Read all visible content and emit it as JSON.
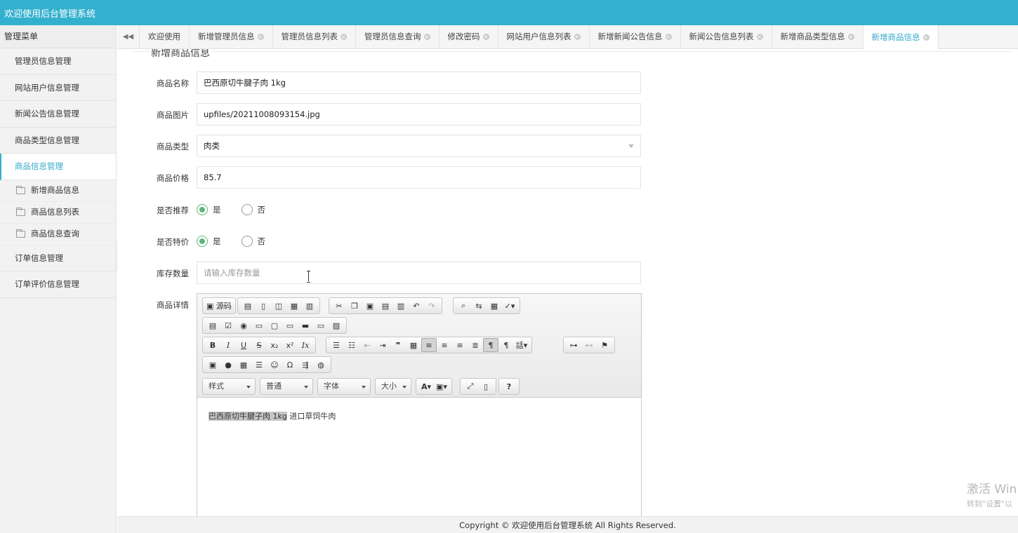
{
  "app": {
    "title": "欢迎使用后台管理系统"
  },
  "sidebar": {
    "header": "管理菜单",
    "items": [
      {
        "label": "管理员信息管理"
      },
      {
        "label": "网站用户信息管理"
      },
      {
        "label": "新闻公告信息管理"
      },
      {
        "label": "商品类型信息管理"
      },
      {
        "label": "商品信息管理"
      }
    ],
    "subitems": [
      {
        "label": "新增商品信息"
      },
      {
        "label": "商品信息列表"
      },
      {
        "label": "商品信息查询"
      }
    ],
    "items_after": [
      {
        "label": "订单信息管理"
      },
      {
        "label": "订单评价信息管理"
      }
    ]
  },
  "tabs": [
    {
      "label": "欢迎使用"
    },
    {
      "label": "新增管理员信息"
    },
    {
      "label": "管理员信息列表"
    },
    {
      "label": "管理员信息查询"
    },
    {
      "label": "修改密码"
    },
    {
      "label": "网站用户信息列表"
    },
    {
      "label": "新增新闻公告信息"
    },
    {
      "label": "新闻公告信息列表"
    },
    {
      "label": "新增商品类型信息"
    },
    {
      "label": "新增商品信息"
    }
  ],
  "form": {
    "legend": "新增商品信息",
    "name": {
      "label": "商品名称",
      "value": "巴西原切牛腱子肉 1kg"
    },
    "image": {
      "label": "商品图片",
      "value": "upfiles/20211008093154.jpg"
    },
    "type": {
      "label": "商品类型",
      "value": "肉类"
    },
    "price": {
      "label": "商品价格",
      "value": "85.7"
    },
    "recommend": {
      "label": "是否推荐",
      "yes": "是",
      "no": "否"
    },
    "special": {
      "label": "是否特价",
      "yes": "是",
      "no": "否"
    },
    "stock": {
      "label": "库存数量",
      "placeholder": "请输入库存数量"
    },
    "detail": {
      "label": "商品详情"
    }
  },
  "editor": {
    "source_label": "源码",
    "combos": {
      "style": "样式",
      "format": "普通",
      "font": "字体",
      "size": "大小"
    },
    "content_selected": "巴西原切牛腱子肉 1kg",
    "content_rest": " 进口草饲牛肉"
  },
  "footer": {
    "text": "Copyright © 欢迎使用后台管理系统 All Rights Reserved."
  },
  "watermark": {
    "line1": "激活 Win",
    "line2": "转到\"设置\"以"
  },
  "colors": {
    "primary": "#33b0ce",
    "radio_on": "#5fb878"
  }
}
